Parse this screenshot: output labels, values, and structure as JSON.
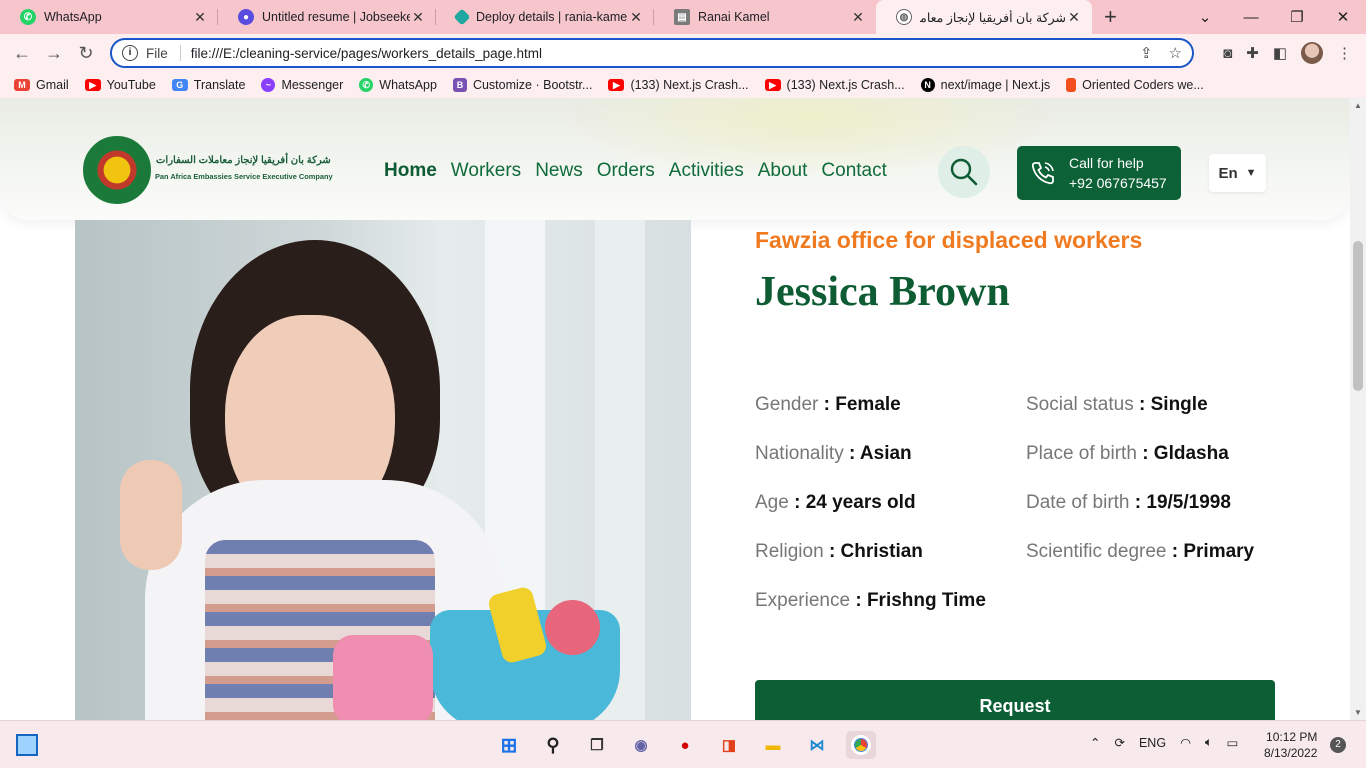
{
  "browser": {
    "tabs": [
      {
        "title": "WhatsApp",
        "icon": "whatsapp-icon",
        "color": "#25d366"
      },
      {
        "title": "Untitled resume | Jobseeker",
        "icon": "jobseeker-icon",
        "color": "#5b4ce0"
      },
      {
        "title": "Deploy details | rania-kamel-",
        "icon": "netlify-icon",
        "color": "#20a7a0"
      },
      {
        "title": "Ranai Kamel",
        "icon": "figma-file-icon",
        "color": "#555555"
      },
      {
        "title": "شركة بان أفريقيا لإنجاز معاملات",
        "icon": "globe-icon",
        "color": "#666666"
      }
    ],
    "address": {
      "scheme_label": "File",
      "url": "file:///E:/cleaning-service/pages/workers_details_page.html"
    },
    "bookmarks": [
      {
        "label": "Gmail",
        "color": "#ea4335"
      },
      {
        "label": "YouTube",
        "color": "#ff0000"
      },
      {
        "label": "Translate",
        "color": "#4285f4"
      },
      {
        "label": "Messenger",
        "color": "#8a3ffc"
      },
      {
        "label": "WhatsApp",
        "color": "#25d366"
      },
      {
        "label": "Customize · Bootstr...",
        "color": "#7952b3"
      },
      {
        "label": "(133) Next.js Crash...",
        "color": "#ff0000"
      },
      {
        "label": "(133) Next.js Crash...",
        "color": "#ff0000"
      },
      {
        "label": "next/image | Next.js",
        "color": "#000000"
      },
      {
        "label": "Oriented Coders we...",
        "color": "#f24e1e"
      }
    ]
  },
  "site": {
    "logo_ar": "شركة بان أفريقيا لإنجاز معاملات السفارات",
    "logo_en": "Pan Africa Embassies Service Executive Company",
    "nav": [
      "Home",
      "Workers",
      "News",
      "Orders",
      "Activities",
      "About",
      "Contact"
    ],
    "call": {
      "line1": "Call for help",
      "line2": "+92 067675457"
    },
    "lang": "En"
  },
  "worker": {
    "office": "Fawzia office for displaced workers",
    "name": "Jessica Brown",
    "details": [
      {
        "label": "Gender",
        "value": ": Female"
      },
      {
        "label": "Social status",
        "value": ": Single"
      },
      {
        "label": "Nationality",
        "value": ": Asian"
      },
      {
        "label": "Place of birth",
        "value": ": Gldasha"
      },
      {
        "label": "Age",
        "value": ": 24 years old"
      },
      {
        "label": "Date of birth",
        "value": ": 19/5/1998"
      },
      {
        "label": "Religion",
        "value": ": Christian"
      },
      {
        "label": "Scientific degree",
        "value": ": Primary"
      },
      {
        "label": "Experience",
        "value": ": Frishng Time"
      }
    ],
    "request_label": "Request"
  },
  "taskbar": {
    "lang": "ENG",
    "time": "10:12 PM",
    "date": "8/13/2022",
    "notifications": "2"
  },
  "colors": {
    "brand_green": "#0c5e35",
    "accent_orange": "#f07a1f",
    "tab_bar": "#f6c6cc"
  }
}
